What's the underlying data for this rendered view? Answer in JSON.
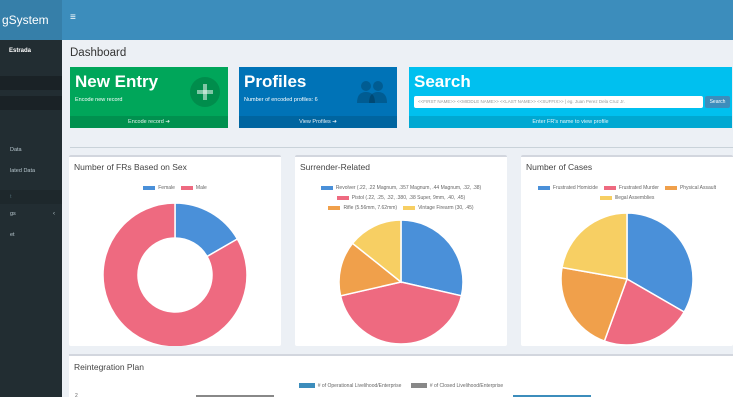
{
  "app": {
    "brand": "gSystem",
    "menu_icon": "hamburger-icon"
  },
  "sidebar": {
    "user_name": "Estrada",
    "items": [
      {
        "label": "Data"
      },
      {
        "label": "lated Data"
      },
      {
        "label": "gs"
      },
      {
        "label": "et"
      }
    ],
    "section_label": "t"
  },
  "page": {
    "title": "Dashboard"
  },
  "tiles": {
    "new_entry": {
      "title": "New Entry",
      "subtitle": "Encode new record",
      "footer": "Encode record ➔",
      "icon": "plus-icon"
    },
    "profiles": {
      "title": "Profiles",
      "subtitle": "Number of encoded profiles: 6",
      "footer": "View Profiles ➔",
      "icon": "users-icon"
    },
    "search": {
      "title": "Search",
      "placeholder": "<<FIRST NAME>> <<MIDDLE NAME>> <<LAST NAME>> <<SUFFIX>> | eg. Juan Perez Dela Cruz Jr.",
      "button": "Search",
      "footer": "Enter FR's name to view profile"
    }
  },
  "panels": {
    "sex": {
      "title": "Number of FRs Based on Sex"
    },
    "surrender": {
      "title": "Surrender-Related"
    },
    "cases": {
      "title": "Number of Cases"
    },
    "reintegration": {
      "title": "Reintegration Plan",
      "legend": [
        "# of Operational Livelihood/Enterprise",
        "# of Closed Livelihood/Enterprise"
      ],
      "colors": [
        "#3c8dbc",
        "#888888"
      ],
      "y_tick": "2"
    }
  },
  "chart_data": [
    {
      "type": "doughnut",
      "categories": [
        "Female",
        "Male"
      ],
      "values": [
        1,
        5
      ],
      "colors": [
        "#4a90d9",
        "#ee6a80"
      ],
      "legend": "top"
    },
    {
      "type": "pie",
      "categories": [
        "Revolver (.22, .22 Magnum, .357 Magnum, .44 Magnum, .32, .38)",
        "Pistol (.22, .25, .32, .380, .38 Super, 9mm, .40, .45)",
        "Rifle (5.56mm, 7.62mm)",
        "Vintage Firearm (30, .45)"
      ],
      "values": [
        2,
        3,
        1,
        1
      ],
      "colors": [
        "#4a90d9",
        "#ee6a80",
        "#f0a04b",
        "#f7cf63"
      ],
      "legend": "top"
    },
    {
      "type": "pie",
      "categories": [
        "Frustrated Homicide",
        "Frustrated Murder",
        "Physical Assault",
        "Illegal Assemblies"
      ],
      "values": [
        3,
        2,
        2,
        2
      ],
      "colors": [
        "#4a90d9",
        "#ee6a80",
        "#f0a04b",
        "#f7cf63"
      ],
      "legend": "top"
    }
  ]
}
